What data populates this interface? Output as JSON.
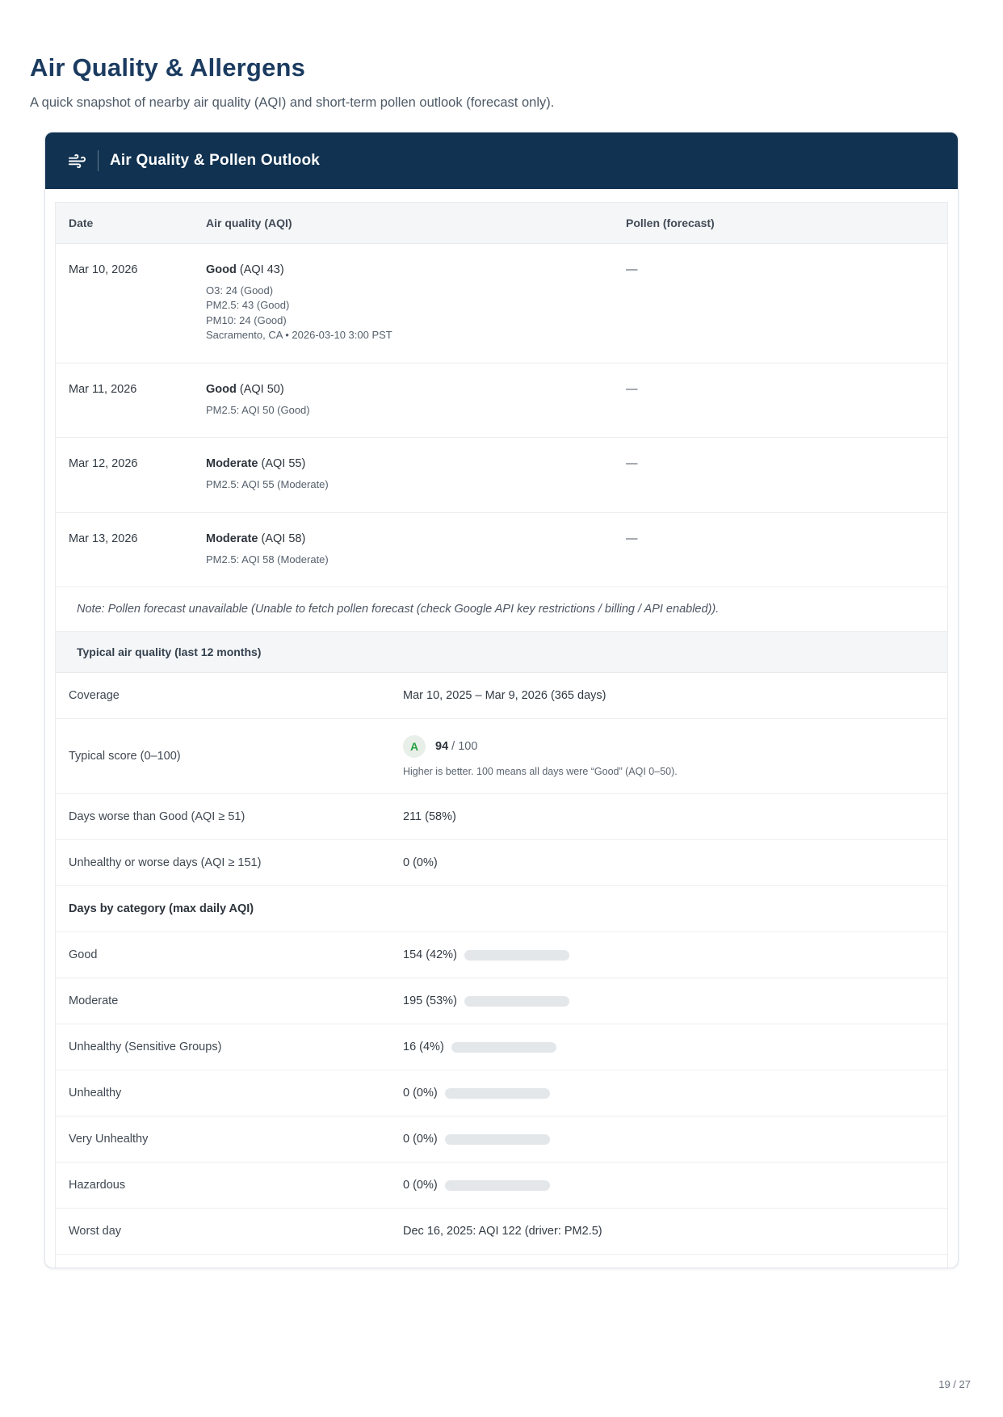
{
  "page": {
    "title": "Air Quality & Allergens",
    "subtitle": "A quick snapshot of nearby air quality (AQI) and short-term pollen outlook (forecast only).",
    "page_number": "19 / 27"
  },
  "card": {
    "header": {
      "title": "Air Quality & Pollen Outlook",
      "icon": "wind-icon"
    },
    "forecast_table": {
      "columns": {
        "date": "Date",
        "air_quality": "Air quality (AQI)",
        "pollen": "Pollen (forecast)"
      },
      "rows": [
        {
          "date": "Mar 10, 2026",
          "category": "Good",
          "aqi_label": "(AQI 43)",
          "details": [
            "O3: 24 (Good)",
            "PM2.5: 43 (Good)",
            "PM10: 24 (Good)",
            "Sacramento, CA • 2026-03-10 3:00 PST"
          ],
          "pollen": "—"
        },
        {
          "date": "Mar 11, 2026",
          "category": "Good",
          "aqi_label": "(AQI 50)",
          "details": [
            "PM2.5: AQI 50 (Good)"
          ],
          "pollen": "—"
        },
        {
          "date": "Mar 12, 2026",
          "category": "Moderate",
          "aqi_label": "(AQI 55)",
          "details": [
            "PM2.5: AQI 55 (Moderate)"
          ],
          "pollen": "—"
        },
        {
          "date": "Mar 13, 2026",
          "category": "Moderate",
          "aqi_label": "(AQI 58)",
          "details": [
            "PM2.5: AQI 58 (Moderate)"
          ],
          "pollen": "—"
        }
      ],
      "note": "Note: Pollen forecast unavailable (Unable to fetch pollen forecast (check Google API key restrictions / billing / API enabled))."
    },
    "summary": {
      "section_title": "Typical air quality (last 12 months)",
      "coverage": {
        "label": "Coverage",
        "value": "Mar 10, 2025 – Mar 9, 2026 (365 days)"
      },
      "typical_score": {
        "label": "Typical score (0–100)",
        "grade": "A",
        "score": "94",
        "suffix": "/ 100",
        "note": "Higher is better. 100 means all days were “Good” (AQI 0–50)."
      },
      "days_worse": {
        "label": "Days worse than Good (AQI ≥ 51)",
        "value": "211 (58%)"
      },
      "unhealthy_days": {
        "label": "Unhealthy or worse days (AQI ≥ 151)",
        "value": "0 (0%)"
      },
      "category_section_title": "Days by category (max daily AQI)",
      "category_rows": [
        {
          "label": "Good",
          "value": "154 (42%)",
          "percent": 42,
          "color": "#28a745"
        },
        {
          "label": "Moderate",
          "value": "195 (53%)",
          "percent": 53,
          "color": "#f9b90b"
        },
        {
          "label": "Unhealthy (Sensitive Groups)",
          "value": "16 (4%)",
          "percent": 4,
          "color": "#f9a11b"
        },
        {
          "label": "Unhealthy",
          "value": "0 (0%)",
          "percent": 0,
          "color": "#e4606d"
        },
        {
          "label": "Very Unhealthy",
          "value": "0 (0%)",
          "percent": 0,
          "color": "#9b59b6"
        },
        {
          "label": "Hazardous",
          "value": "0 (0%)",
          "percent": 0,
          "color": "#7e3541"
        }
      ],
      "worst_day": {
        "label": "Worst day",
        "value": "Dec 16, 2025: AQI 122 (driver: PM2.5)"
      }
    },
    "colors": {
      "header_bg": "#113250",
      "accent_green": "#28a745",
      "accent_amber": "#f9b90b",
      "grade_green": "#27a043"
    }
  }
}
